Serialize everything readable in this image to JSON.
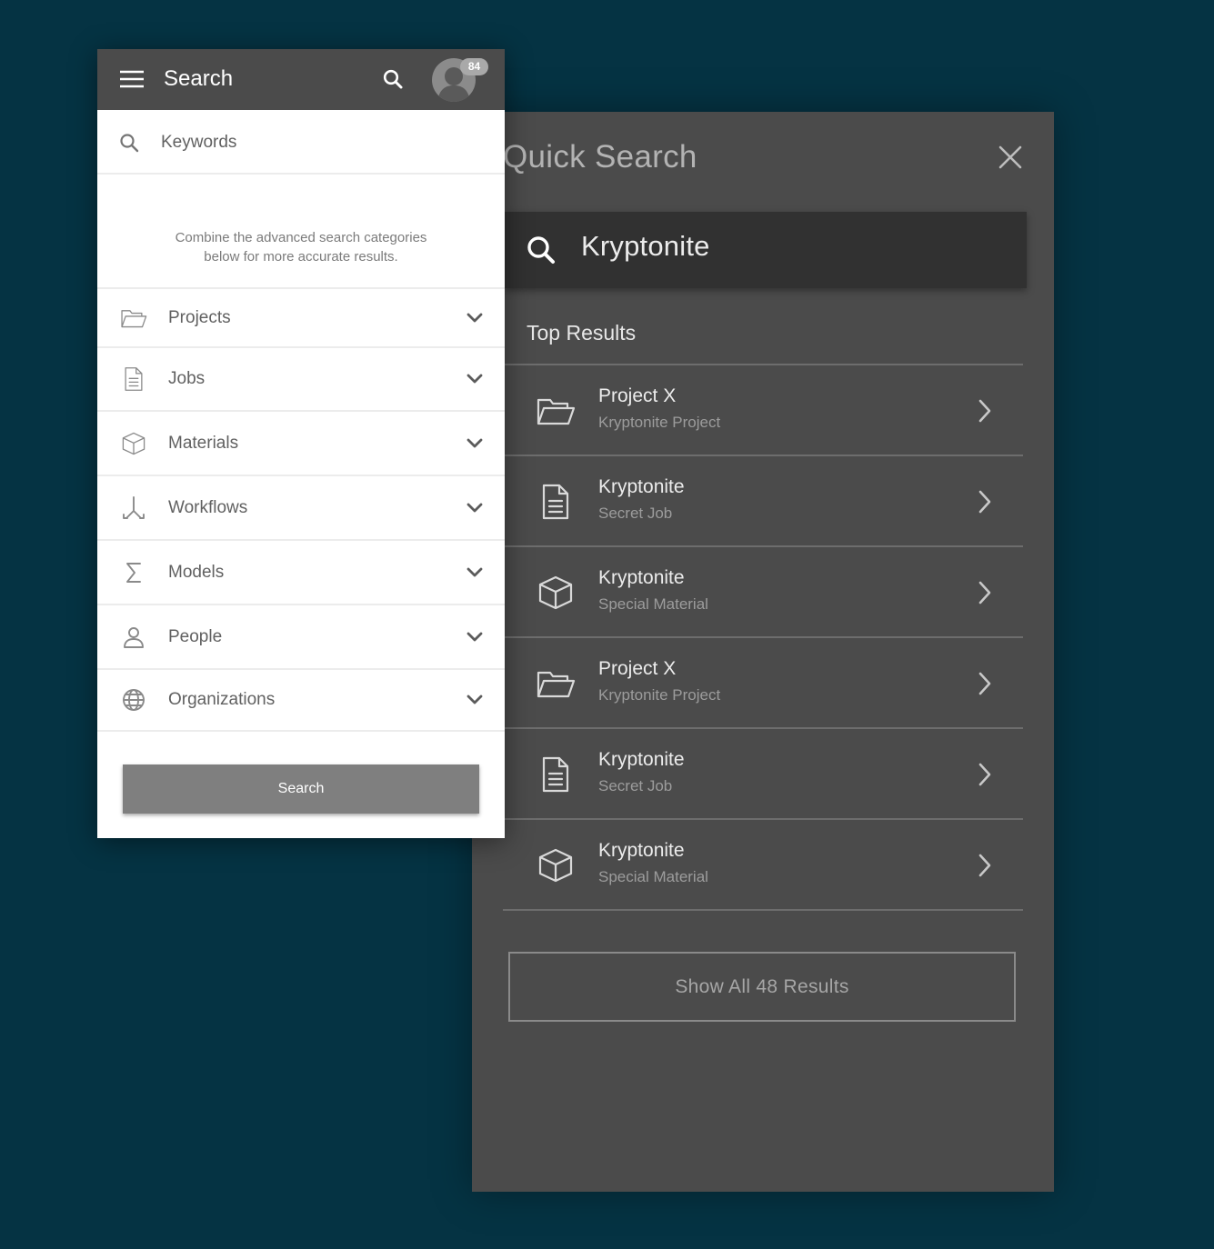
{
  "quick_search": {
    "title": "Quick Search",
    "query": "Kryptonite",
    "section_title": "Top Results",
    "results": [
      {
        "title": "Project X",
        "subtitle": "Kryptonite Project",
        "icon": "folder-icon"
      },
      {
        "title": "Kryptonite",
        "subtitle": "Secret Job",
        "icon": "document-icon"
      },
      {
        "title": "Kryptonite",
        "subtitle": "Special Material",
        "icon": "cube-icon"
      },
      {
        "title": "Project X",
        "subtitle": "Kryptonite Project",
        "icon": "folder-icon"
      },
      {
        "title": "Kryptonite",
        "subtitle": "Secret Job",
        "icon": "document-icon"
      },
      {
        "title": "Kryptonite",
        "subtitle": "Special Material",
        "icon": "cube-icon"
      }
    ],
    "show_all_label": "Show All 48 Results"
  },
  "advanced_search": {
    "header_title": "Search",
    "notification_count": "84",
    "keywords_placeholder": "Keywords",
    "hint_line1": "Combine the advanced search categories",
    "hint_line2": "below for more accurate results.",
    "categories": [
      {
        "label": "Projects",
        "icon": "folder-icon"
      },
      {
        "label": "Jobs",
        "icon": "document-icon"
      },
      {
        "label": "Materials",
        "icon": "cube-icon"
      },
      {
        "label": "Workflows",
        "icon": "workflow-icon"
      },
      {
        "label": "Models",
        "icon": "sigma-icon"
      },
      {
        "label": "People",
        "icon": "person-icon"
      },
      {
        "label": "Organizations",
        "icon": "globe-icon"
      }
    ],
    "search_button_label": "Search"
  },
  "colors": {
    "background": "#053343",
    "dark_panel": "#4b4b4b",
    "search_field": "#313131",
    "button_gray": "#7f7f7f"
  }
}
